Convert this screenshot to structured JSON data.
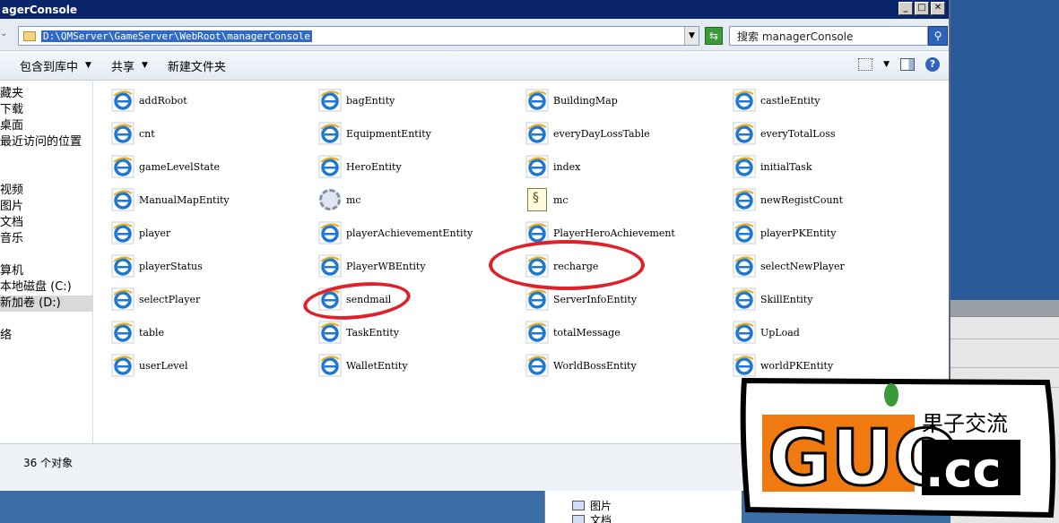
{
  "window": {
    "title": "agerConsole"
  },
  "address": {
    "path": "D:\\QMServer\\GameServer\\WebRoot\\managerConsole"
  },
  "search": {
    "text": "搜索 managerConsole"
  },
  "toolbar": {
    "include": "包含到库中",
    "share": "共享",
    "newfolder": "新建文件夹"
  },
  "sidebar": {
    "items": [
      "藏夹",
      "下载",
      "桌面",
      "最近访问的位置",
      "视频",
      "图片",
      "文档",
      "音乐",
      "算机",
      "本地磁盘 (C:)",
      "新加卷 (D:)",
      "络"
    ]
  },
  "files": [
    {
      "name": "addRobot",
      "icon": "ie-icon"
    },
    {
      "name": "bagEntity",
      "icon": "ie-icon"
    },
    {
      "name": "BuildingMap",
      "icon": "ie-icon"
    },
    {
      "name": "castleEntity",
      "icon": "ie-icon"
    },
    {
      "name": "cnt",
      "icon": "ie-icon"
    },
    {
      "name": "EquipmentEntity",
      "icon": "ie-icon"
    },
    {
      "name": "everyDayLossTable",
      "icon": "ie-icon"
    },
    {
      "name": "everyTotalLoss",
      "icon": "ie-icon"
    },
    {
      "name": "gameLevelState",
      "icon": "ie-icon"
    },
    {
      "name": "HeroEntity",
      "icon": "ie-icon"
    },
    {
      "name": "index",
      "icon": "ie-icon"
    },
    {
      "name": "initialTask",
      "icon": "ie-icon"
    },
    {
      "name": "ManualMapEntity",
      "icon": "ie-icon"
    },
    {
      "name": "mc",
      "icon": "gear-icon"
    },
    {
      "name": "mc",
      "icon": "script-icon"
    },
    {
      "name": "newRegistCount",
      "icon": "ie-icon"
    },
    {
      "name": "player",
      "icon": "ie-icon"
    },
    {
      "name": "playerAchievementEntity",
      "icon": "ie-icon"
    },
    {
      "name": "PlayerHeroAchievement",
      "icon": "ie-icon"
    },
    {
      "name": "playerPKEntity",
      "icon": "ie-icon"
    },
    {
      "name": "playerStatus",
      "icon": "ie-icon"
    },
    {
      "name": "PlayerWBEntity",
      "icon": "ie-icon"
    },
    {
      "name": "recharge",
      "icon": "ie-icon"
    },
    {
      "name": "selectNewPlayer",
      "icon": "ie-icon"
    },
    {
      "name": "selectPlayer",
      "icon": "ie-icon"
    },
    {
      "name": "sendmail",
      "icon": "ie-icon"
    },
    {
      "name": "ServerInfoEntity",
      "icon": "ie-icon"
    },
    {
      "name": "SkillEntity",
      "icon": "ie-icon"
    },
    {
      "name": "table",
      "icon": "ie-icon"
    },
    {
      "name": "TaskEntity",
      "icon": "ie-icon"
    },
    {
      "name": "totalMessage",
      "icon": "ie-icon"
    },
    {
      "name": "UpLoad",
      "icon": "ie-icon"
    },
    {
      "name": "userLevel",
      "icon": "ie-icon"
    },
    {
      "name": "WalletEntity",
      "icon": "ie-icon"
    },
    {
      "name": "WorldBossEntity",
      "icon": "ie-icon"
    },
    {
      "name": "worldPKEntity",
      "icon": "ie-icon"
    }
  ],
  "status": {
    "count": "36 个对象"
  },
  "background": {
    "item1": "图片",
    "item2": "文档"
  },
  "watermark": {
    "brand": "GUO",
    "domain": ".cc",
    "tagline": "果子交流"
  },
  "colors": {
    "titlebar": "#0a246a",
    "selection": "#316ac5",
    "annotation": "#e0202a",
    "logo_orange": "#f07a10"
  }
}
